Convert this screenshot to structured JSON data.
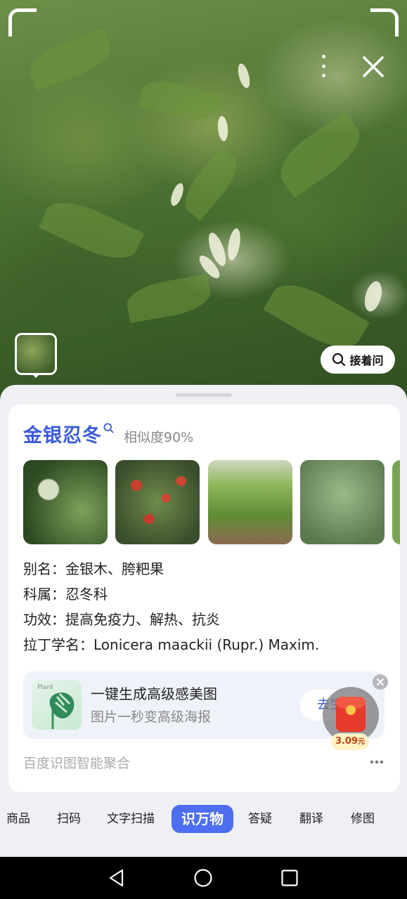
{
  "camera": {
    "ask_button_label": "接着问"
  },
  "result": {
    "plant_name": "金银忍冬",
    "similarity": "相似度90%",
    "info_lines": [
      "别名：金银木、胯粑果",
      "科属：忍冬科",
      "功效：提高免疫力、解热、抗炎",
      "拉丁学名：Lonicera maackii (Rupr.) Maxim."
    ]
  },
  "promo": {
    "image_label": "Plant",
    "title": "一键生成高级感美图",
    "subtitle": "图片一秒变高级海报",
    "button_label": "去生"
  },
  "reward": {
    "amount": "3.09",
    "unit": "元"
  },
  "footer": {
    "label": "百度识图智能聚合"
  },
  "tabs": [
    "商品",
    "扫码",
    "文字扫描",
    "识万物",
    "答疑",
    "翻译",
    "修图"
  ],
  "active_tab": "识万物",
  "colors": {
    "accent": "#3a5bd8",
    "active_tab_bg": "#4d6ef0",
    "red_packet": "#e83a2c"
  },
  "icons": [
    "more-icon",
    "close-icon",
    "search-icon",
    "back-icon",
    "home-icon",
    "recents-icon"
  ]
}
